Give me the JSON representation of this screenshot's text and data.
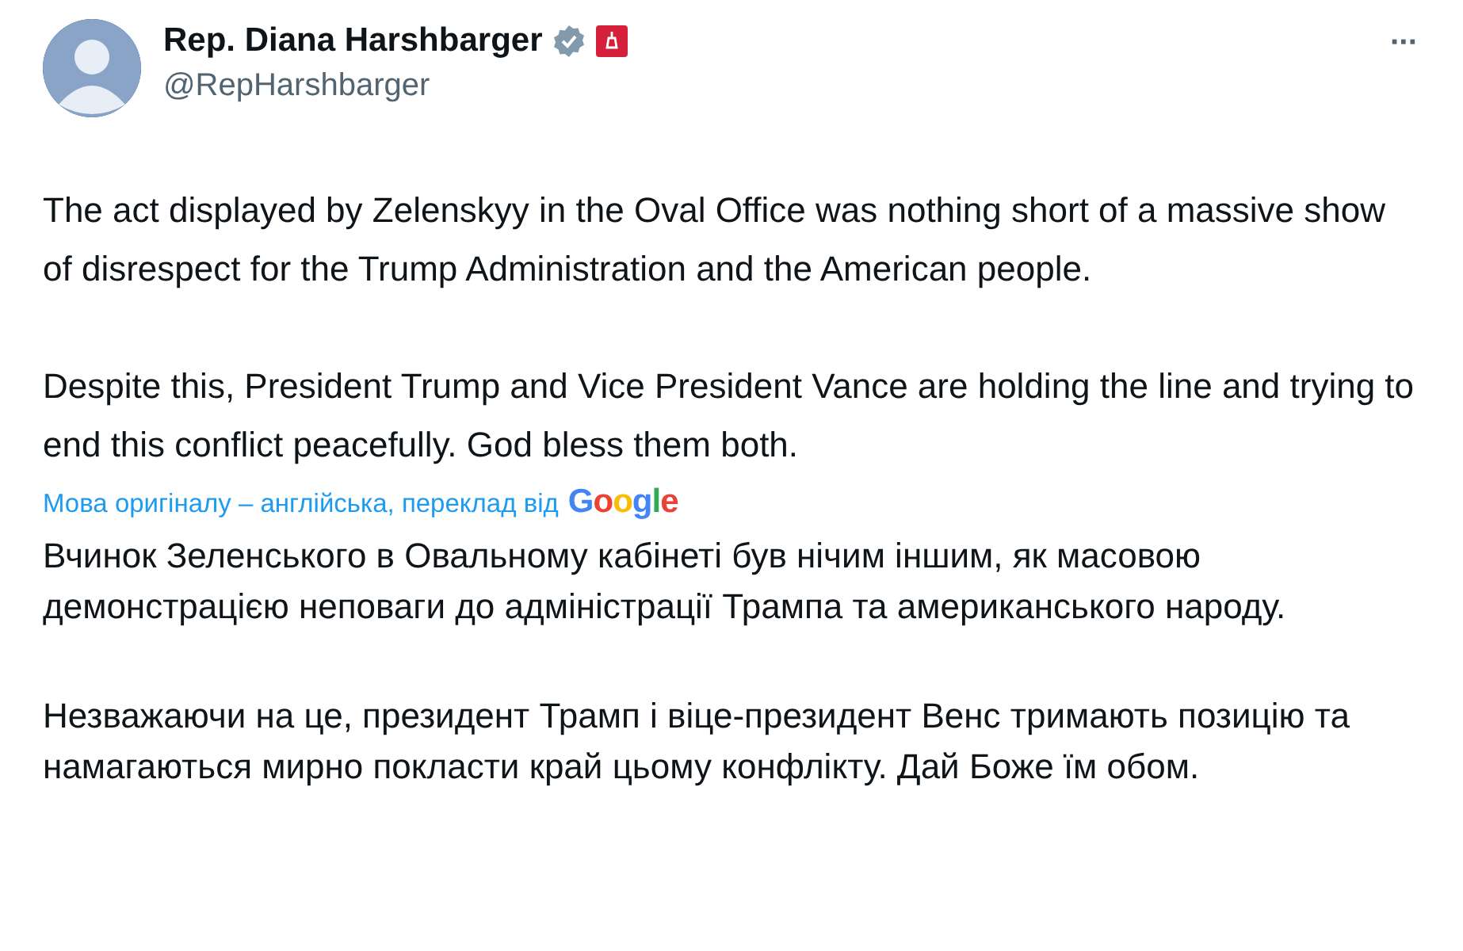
{
  "author": {
    "name": "Rep. Diana Harshbarger",
    "verified": true,
    "handle": "@RepHarshbarger"
  },
  "more_button": {
    "label": "···"
  },
  "paragraphs": [
    "The act displayed by Zelenskyy in the Oval Office was nothing short of a massive show of disrespect for the Trump Administration and the American people.",
    "Despite this, President Trump and Vice President Vance are holding the line and trying to end this conflict peacefully. God bless them both."
  ],
  "translation_notice": {
    "text": "Мова оригіналу – англійська, переклад від",
    "provider": "Google"
  },
  "translated_paragraphs": [
    "Вчинок Зеленського в Овальному кабінеті був нічим іншим, як масовою демонстрацією неповаги до адміністрації Трампа та американського народу.",
    "Незважаючи на це, президент Трамп і віце-президент Венс тримають позицію та намагаються мирно покласти край цьому конфлікту. Дай Боже їм обом."
  ]
}
